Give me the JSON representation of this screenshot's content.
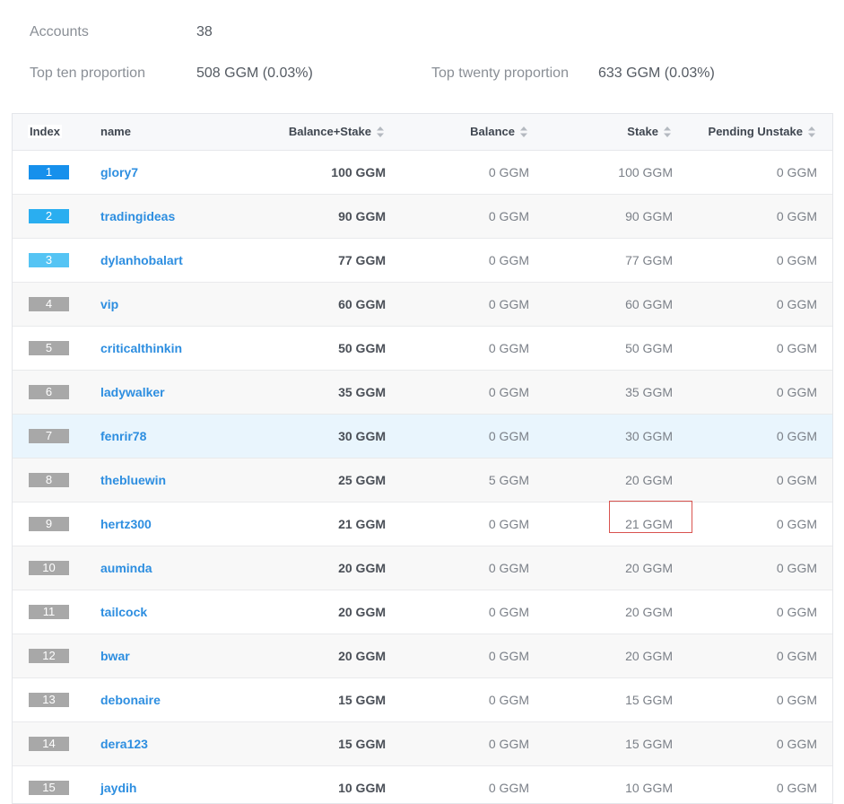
{
  "summary": {
    "accounts_label": "Accounts",
    "accounts_value": "38",
    "top_ten_label": "Top ten proportion",
    "top_ten_value": "508 GGM (0.03%)",
    "top_twenty_label": "Top twenty proportion",
    "top_twenty_value": "633 GGM (0.03%)"
  },
  "table": {
    "headers": {
      "index": "Index",
      "name": "name",
      "balance_stake": "Balance+Stake",
      "balance": "Balance",
      "stake": "Stake",
      "pending_unstake": "Pending Unstake"
    },
    "rank_colors": [
      "#1690ec",
      "#2aaef0",
      "#55c4f4",
      "#a8a8a8"
    ],
    "rows": [
      {
        "index": "1",
        "name": "glory7",
        "balance_stake": "100 GGM",
        "balance": "0 GGM",
        "stake": "100 GGM",
        "pending_unstake": "0 GGM"
      },
      {
        "index": "2",
        "name": "tradingideas",
        "balance_stake": "90 GGM",
        "balance": "0 GGM",
        "stake": "90 GGM",
        "pending_unstake": "0 GGM"
      },
      {
        "index": "3",
        "name": "dylanhobalart",
        "balance_stake": "77 GGM",
        "balance": "0 GGM",
        "stake": "77 GGM",
        "pending_unstake": "0 GGM"
      },
      {
        "index": "4",
        "name": "vip",
        "balance_stake": "60 GGM",
        "balance": "0 GGM",
        "stake": "60 GGM",
        "pending_unstake": "0 GGM"
      },
      {
        "index": "5",
        "name": "criticalthinkin",
        "balance_stake": "50 GGM",
        "balance": "0 GGM",
        "stake": "50 GGM",
        "pending_unstake": "0 GGM"
      },
      {
        "index": "6",
        "name": "ladywalker",
        "balance_stake": "35 GGM",
        "balance": "0 GGM",
        "stake": "35 GGM",
        "pending_unstake": "0 GGM"
      },
      {
        "index": "7",
        "name": "fenrir78",
        "balance_stake": "30 GGM",
        "balance": "0 GGM",
        "stake": "30 GGM",
        "pending_unstake": "0 GGM"
      },
      {
        "index": "8",
        "name": "thebluewin",
        "balance_stake": "25 GGM",
        "balance": "5 GGM",
        "stake": "20 GGM",
        "pending_unstake": "0 GGM"
      },
      {
        "index": "9",
        "name": "hertz300",
        "balance_stake": "21 GGM",
        "balance": "0 GGM",
        "stake": "21 GGM",
        "pending_unstake": "0 GGM"
      },
      {
        "index": "10",
        "name": "auminda",
        "balance_stake": "20 GGM",
        "balance": "0 GGM",
        "stake": "20 GGM",
        "pending_unstake": "0 GGM"
      },
      {
        "index": "11",
        "name": "tailcock",
        "balance_stake": "20 GGM",
        "balance": "0 GGM",
        "stake": "20 GGM",
        "pending_unstake": "0 GGM"
      },
      {
        "index": "12",
        "name": "bwar",
        "balance_stake": "20 GGM",
        "balance": "0 GGM",
        "stake": "20 GGM",
        "pending_unstake": "0 GGM"
      },
      {
        "index": "13",
        "name": "debonaire",
        "balance_stake": "15 GGM",
        "balance": "0 GGM",
        "stake": "15 GGM",
        "pending_unstake": "0 GGM"
      },
      {
        "index": "14",
        "name": "dera123",
        "balance_stake": "15 GGM",
        "balance": "0 GGM",
        "stake": "15 GGM",
        "pending_unstake": "0 GGM"
      },
      {
        "index": "15",
        "name": "jaydih",
        "balance_stake": "10 GGM",
        "balance": "0 GGM",
        "stake": "10 GGM",
        "pending_unstake": "0 GGM"
      }
    ]
  }
}
